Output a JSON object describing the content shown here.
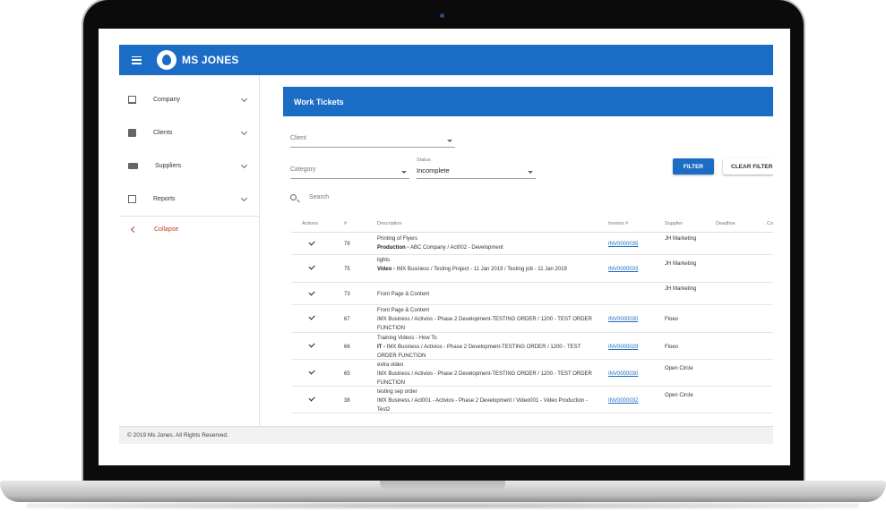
{
  "header": {
    "brand": "MS JONES"
  },
  "sidebar": {
    "items": [
      {
        "label": "Company",
        "icon": "building-icon"
      },
      {
        "label": "Clients",
        "icon": "contacts-icon"
      },
      {
        "label": "Suppliers",
        "icon": "truck-icon"
      },
      {
        "label": "Reports",
        "icon": "chart-icon"
      }
    ],
    "collapse_label": "Collapse"
  },
  "main": {
    "title": "Work Tickets",
    "filters": {
      "client_label": "Client",
      "category_label": "Category",
      "status_label": "Status",
      "status_value": "Incomplete",
      "filter_button": "FILTER",
      "clear_button": "CLEAR FILTER",
      "search_placeholder": "Search"
    },
    "table": {
      "columns": [
        "Actions",
        "#",
        "Description",
        "Invoice #",
        "Supplier",
        "Deadline",
        "Co"
      ],
      "rows": [
        {
          "num": "79",
          "desc_line1": "Printing of Flyers",
          "desc_bold": "Production - ",
          "desc_rest": "ABC Company / Act002 - Development",
          "invoice": "INV0000035",
          "supplier": "JH Marketing",
          "deadline": ""
        },
        {
          "num": "75",
          "desc_line1": "lights",
          "desc_bold": "Video - ",
          "desc_rest": "IMX Business / Testing Project - 11 Jan 2019 / Testing job - 11 Jan 2019",
          "invoice": "INV0000033",
          "supplier": "JH Marketing",
          "deadline": ""
        },
        {
          "num": "73",
          "desc_line1": "Front Page & Content",
          "desc_bold": "",
          "desc_rest": "",
          "invoice": "",
          "supplier": "JH Marketing",
          "deadline": ""
        },
        {
          "num": "67",
          "desc_line1": "Front Page & Content",
          "desc_bold": "",
          "desc_rest": "IMX Business / Activios - Phase 2 Development-TESTING ORDER / 1200 - TEST ORDER FUNCTION",
          "invoice": "INV0000030",
          "supplier": "Floeo",
          "deadline": ""
        },
        {
          "num": "66",
          "desc_line1": "Training Videos - How To",
          "desc_bold": "IT - ",
          "desc_rest": "IMX Business / Activios - Phase 2 Development-TESTING ORDER / 1200 - TEST ORDER FUNCTION",
          "invoice": "INV0000029",
          "supplier": "Floeo",
          "deadline": ""
        },
        {
          "num": "65",
          "desc_line1": "extra video",
          "desc_bold": "",
          "desc_rest": "IMX Business / Activios - Phase 2 Development-TESTING ORDER / 1200 - TEST ORDER FUNCTION",
          "invoice": "INV0000030",
          "supplier": "Open Circle",
          "deadline": ""
        },
        {
          "num": "38",
          "desc_line1": "testing sep order",
          "desc_bold": "",
          "desc_rest": "IMX Business / Act001 - Activios - Phase 2 Development / Video001 - Video Production - Test2",
          "invoice": "INV0000032",
          "supplier": "Open Circle",
          "deadline": ""
        }
      ]
    }
  },
  "footer": {
    "text": "© 2019 Ms Jones. All Rights Reserved."
  }
}
